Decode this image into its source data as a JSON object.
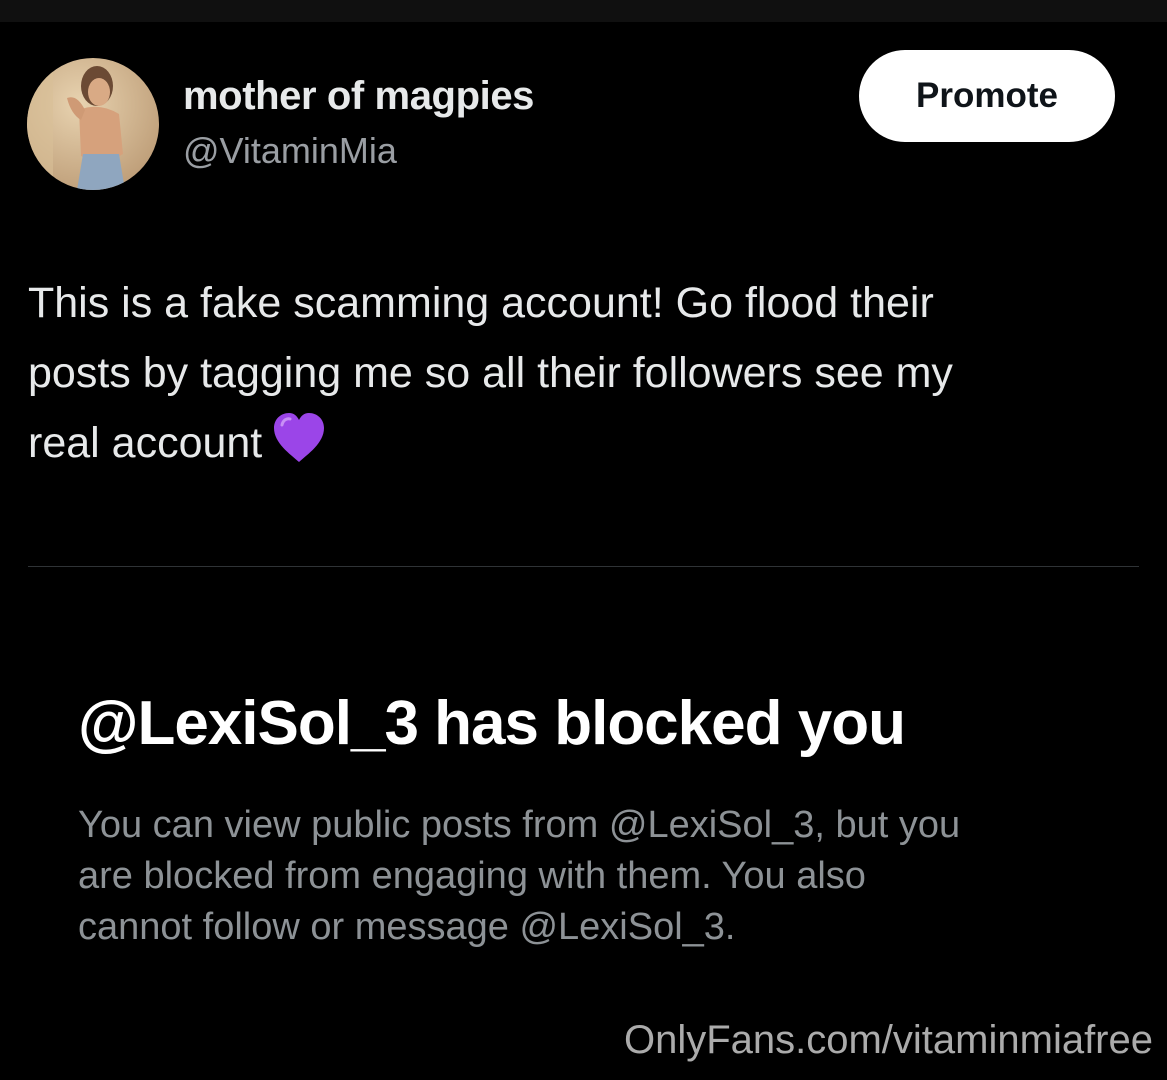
{
  "tweet": {
    "author": {
      "display_name": "mother of magpies",
      "handle": "@VitaminMia"
    },
    "promote_label": "Promote",
    "text_lines": [
      "This is a fake scamming account! Go flood their",
      "posts by tagging me so all their followers see my",
      "real account"
    ],
    "emoji": "purple-heart-icon"
  },
  "blocked_notice": {
    "title": "@LexiSol_3 has blocked you",
    "body_lines": [
      "You can view public posts from @LexiSol_3, but you",
      "are blocked from engaging with them. You also",
      "cannot follow or message @LexiSol_3."
    ]
  },
  "watermark": "OnlyFans.com/vitaminmiafree",
  "colors": {
    "background": "#000000",
    "primary_text": "#e7e9ea",
    "secondary_text": "#9a9ea3",
    "divider": "#2f3336",
    "promote_bg": "#ffffff",
    "emoji_purple": "#9b45e8"
  }
}
